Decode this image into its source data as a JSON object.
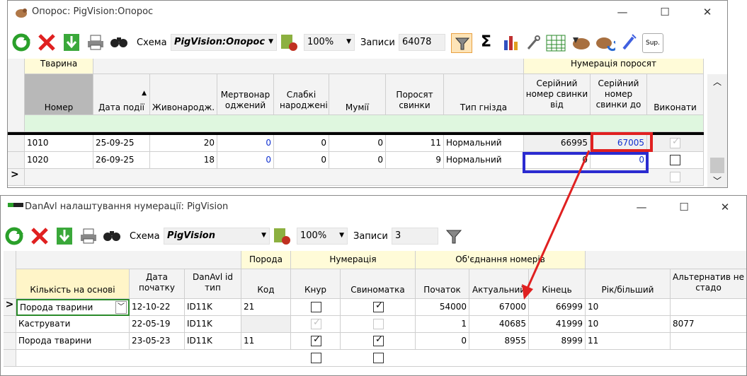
{
  "win1": {
    "title": "Опорос: PigVision:Опорос",
    "scheme_label": "Схема",
    "scheme_value": "PigVision:Опорос",
    "zoom": "100%",
    "records_label": "Записи",
    "records_value": "64078",
    "sup_label": "Sup.",
    "group_headers": {
      "animal": "Тварина",
      "numbering": "Нумерація поросят"
    },
    "columns": [
      "Номер",
      "Дата події",
      "Живонародж.",
      "Мертвонар оджений",
      "Слабкі народжені",
      "Мумії",
      "Поросят свинки",
      "Тип гнізда",
      "Серійний номер свинки від",
      "Серійний номер свинки до",
      "Виконати"
    ],
    "sort_arrow": "▲",
    "rows": [
      {
        "number": "1010",
        "date": "25-09-25",
        "live": "20",
        "dead": "0",
        "weak": "0",
        "mummies": "0",
        "piglets": "11",
        "nest": "Нормальний",
        "from": "66995",
        "to": "67005",
        "done": true
      },
      {
        "number": "1020",
        "date": "26-09-25",
        "live": "18",
        "dead": "0",
        "weak": "0",
        "mummies": "0",
        "piglets": "9",
        "nest": "Нормальний",
        "from": "0",
        "to": "0",
        "done": false
      }
    ],
    "new_row_marker": ">"
  },
  "win2": {
    "title": "DanAvl налаштування нумерації: PigVision",
    "scheme_label": "Схема",
    "scheme_value": "PigVision",
    "zoom": "100%",
    "records_label": "Записи",
    "records_value": "3",
    "group_headers": {
      "breed": "Порода",
      "numbering": "Нумерація",
      "merge": "Об'єднання номерів"
    },
    "columns": [
      "Кількість на основі",
      "Дата початку",
      "DanAvl id тип",
      "Код",
      "Кнур",
      "Свиноматка",
      "Початок",
      "Актуальний",
      "Кінець",
      "Рік/більший",
      "Альтернатив не стадо"
    ],
    "rows": [
      {
        "basis": "Порода тварини",
        "date": "12-10-22",
        "type": "ID11K",
        "code": "21",
        "boar": false,
        "sow": true,
        "start": "54000",
        "current": "67000",
        "end": "66999",
        "year": "10",
        "alt": ""
      },
      {
        "basis": "Каструвати",
        "date": "22-05-19",
        "type": "ID11K",
        "code": "",
        "boar": true,
        "sow": false,
        "start": "1",
        "current": "40685",
        "end": "41999",
        "year": "10",
        "alt": "8077"
      },
      {
        "basis": "Порода тварини",
        "date": "23-05-23",
        "type": "ID11K",
        "code": "11",
        "boar": true,
        "sow": true,
        "start": "0",
        "current": "8955",
        "end": "8999",
        "year": "11",
        "alt": ""
      }
    ],
    "current_row_marker": ">"
  },
  "colors": {
    "highlight_red": "#e02020",
    "highlight_blue": "#2b2bd0",
    "group_header_bg": "#fffbd8",
    "filter_row_bg": "#dff7df",
    "link_blue": "#1030d0"
  }
}
